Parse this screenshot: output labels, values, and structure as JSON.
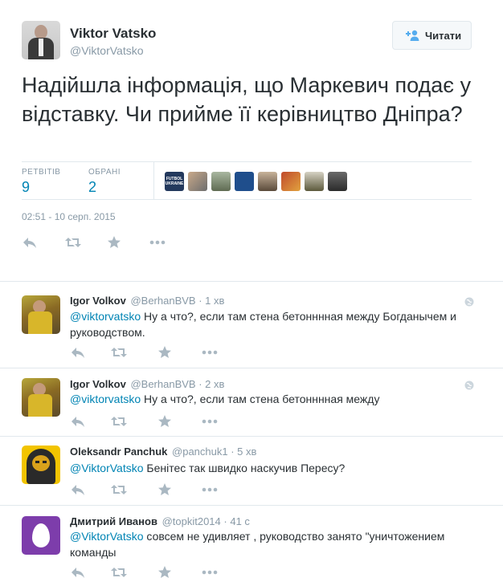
{
  "main_tweet": {
    "name": "Viktor Vatsko",
    "handle": "@ViktorVatsko",
    "follow_label": "Читати",
    "text": "Надійшла інформація, що Маркевич подає у відставку. Чи прийме її керівництво Дніпра?",
    "retweets_label": "РЕТВІТІВ",
    "retweets_count": "9",
    "favorites_label": "ОБРАНІ",
    "favorites_count": "2",
    "favoriters_thumbnail_text": "FUTBOL UKRAINE",
    "timestamp": "02:51 - 10 серп. 2015"
  },
  "replies": [
    {
      "name": "Igor Volkov",
      "handle": "@BerhanBVB",
      "time": "· 1 хв",
      "mention": "@viktorvatsko",
      "text": " Ну а что?, если там стена бетонннная между Богданычем и руководством."
    },
    {
      "name": "Igor Volkov",
      "handle": "@BerhanBVB",
      "time": "· 2 хв",
      "mention": "@viktorvatsko",
      "text": " Ну а что?, если там стена бетонннная между"
    },
    {
      "name": "Oleksandr Panchuk",
      "handle": "@panchuk1",
      "time": "· 5 хв",
      "mention": "@ViktorVatsko",
      "text": " Бенітес так швидко наскучив Пересу?"
    },
    {
      "name": "Дмитрий Иванов",
      "handle": "@topkit2014",
      "time": "· 41 с",
      "mention": "@ViktorVatsko",
      "text": " совсем не удивляет , руководство занято \"уничтожением команды"
    }
  ],
  "colors": {
    "link": "#0084b4",
    "muted": "#8899a6",
    "border": "#e1e8ed",
    "egg_avatar": "#7d3dab"
  },
  "icons": [
    "follow-person-icon",
    "reply-icon",
    "retweet-icon",
    "favorite-icon",
    "more-icon",
    "globe-icon"
  ]
}
